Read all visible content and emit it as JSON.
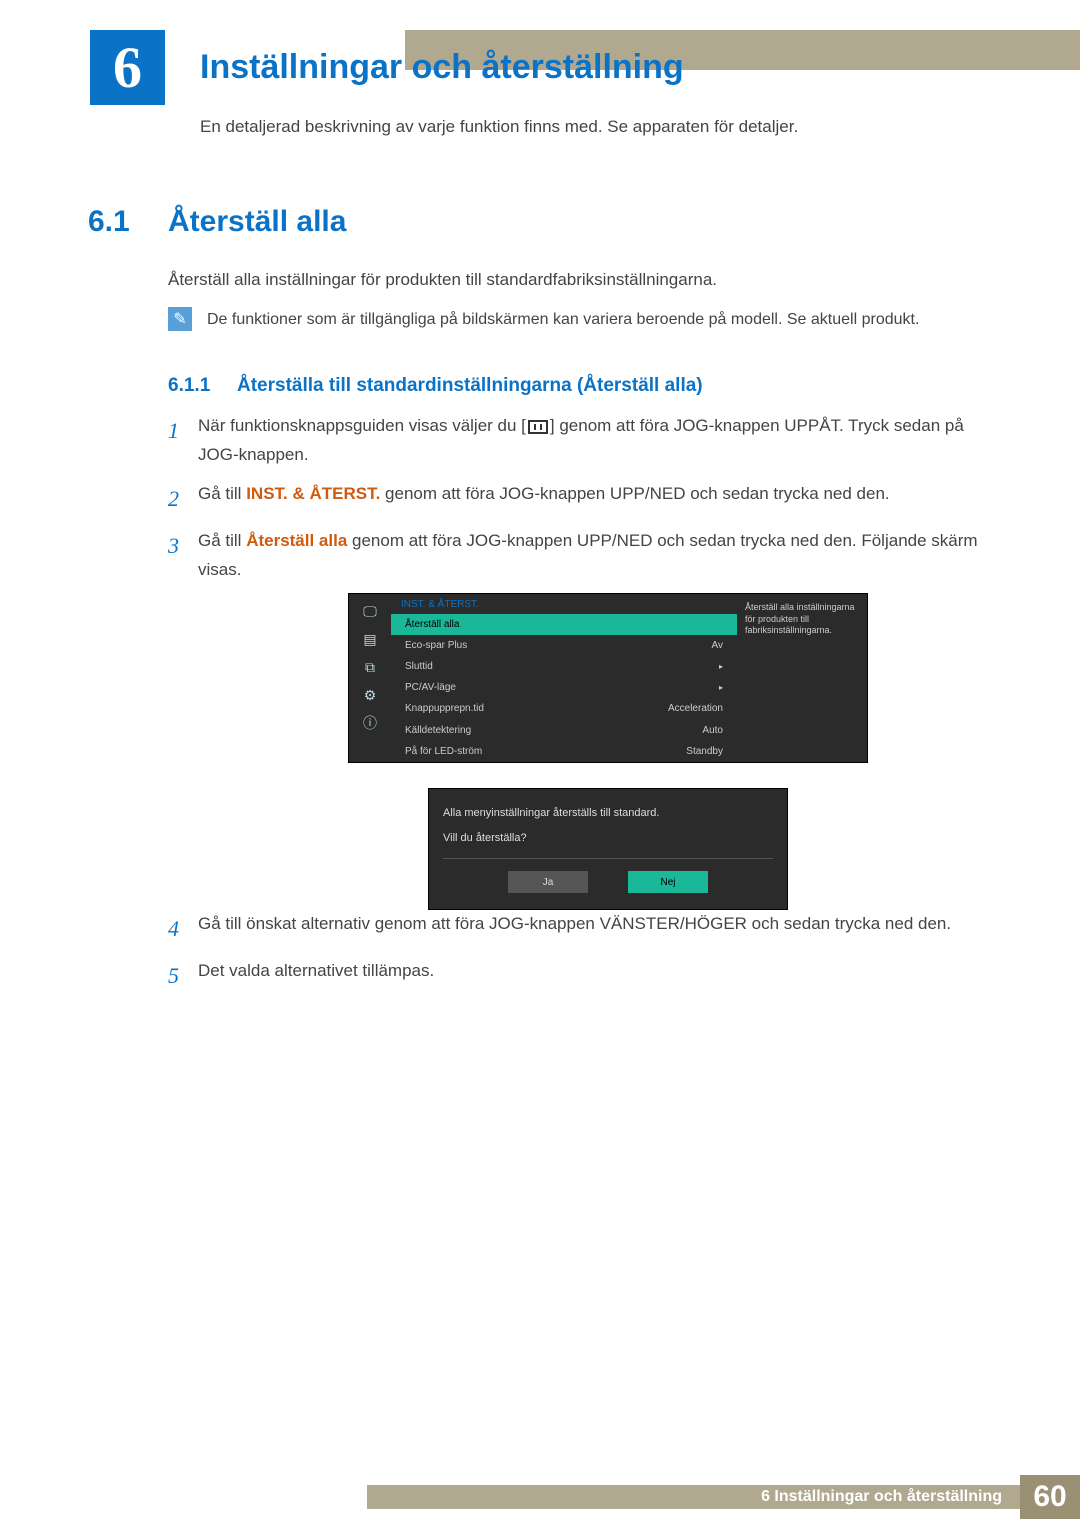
{
  "chapter": {
    "number": "6",
    "title": "Inställningar och återställning",
    "desc": "En detaljerad beskrivning av varje funktion finns med. Se apparaten för detaljer."
  },
  "section": {
    "number": "6.1",
    "title": "Återställ alla",
    "desc": "Återställ alla inställningar för produkten till standardfabriksinställningarna."
  },
  "note": "De funktioner som är tillgängliga på bildskärmen kan variera beroende på modell. Se aktuell produkt.",
  "subsection": {
    "number": "6.1.1",
    "title": "Återställa till standardinställningarna (Återställ alla)"
  },
  "steps": {
    "s1_a": "När funktionsknappsguiden visas väljer du [",
    "s1_b": "] genom att föra JOG-knappen UPPÅT. Tryck sedan på JOG-knappen.",
    "s2_a": "Gå till ",
    "s2_hl": "INST. & ÅTERST.",
    "s2_b": " genom att föra JOG-knappen UPP/NED och sedan trycka ned den.",
    "s3_a": "Gå till ",
    "s3_hl": "Återställ alla",
    "s3_b": " genom att föra JOG-knappen UPP/NED och sedan trycka ned den. Följande skärm visas.",
    "s4": "Gå till önskat alternativ genom att föra JOG-knappen VÄNSTER/HÖGER och sedan trycka ned den.",
    "s5": "Det valda alternativet tillämpas."
  },
  "osd": {
    "title": "INST. & ÅTERST.",
    "side_desc": "Återställ alla inställningarna för produkten till fabriksinställningarna.",
    "rows": [
      {
        "label": "Återställ alla",
        "value": ""
      },
      {
        "label": "Eco-spar Plus",
        "value": "Av"
      },
      {
        "label": "Sluttid",
        "value": "▸"
      },
      {
        "label": "PC/AV-läge",
        "value": "▸"
      },
      {
        "label": "Knappupprepn.tid",
        "value": "Acceleration"
      },
      {
        "label": "Källdetektering",
        "value": "Auto"
      },
      {
        "label": "På för LED-ström",
        "value": "Standby"
      }
    ],
    "dialog": {
      "line1": "Alla menyinställningar återställs till standard.",
      "line2": "Vill du återställa?",
      "yes": "Ja",
      "no": "Nej"
    }
  },
  "footer": {
    "text": "6 Inställningar och återställning",
    "page": "60"
  }
}
